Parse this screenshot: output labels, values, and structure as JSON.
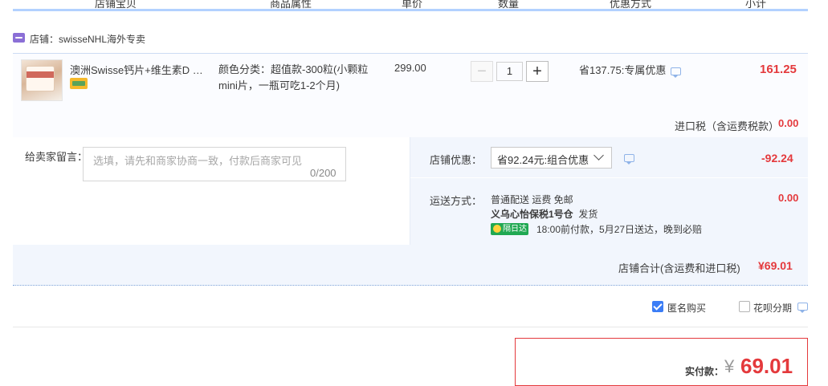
{
  "header": {
    "cols": [
      "店铺宝贝",
      "商品属性",
      "单价",
      "数量",
      "优惠方式",
      "小计"
    ]
  },
  "store": {
    "name": "店铺：swisseNHL海外专卖"
  },
  "item": {
    "title": "澳洲Swisse钙片+维生素D mini片",
    "attribute": "颜色分类：超值款-300粒(小颗粒mini片，一瓶可吃1-2个月)",
    "price": "299.00",
    "quantity": "1",
    "discount": "省137.75:专属优惠",
    "subtotal": "161.25",
    "tax_label": "进口税（含运费税款）",
    "tax_value": "0.00"
  },
  "note": {
    "label": "给卖家留言：",
    "placeholder": "选填，请先和商家协商一致，付款后商家可见",
    "count": "0/200"
  },
  "promo": {
    "label": "店铺优惠：",
    "selected": "省92.24元:组合优惠",
    "value": "-92.24"
  },
  "shipping": {
    "label": "运送方式：",
    "line1": "普通配送 运费 免邮",
    "warehouse": "义乌心怡保税1号仓",
    "ship_text": "发货",
    "badge": "隔日达",
    "delivery": "18:00前付款，5月27日送达，晚到必赔",
    "value": "0.00"
  },
  "total": {
    "label": "店铺合计(含运费和进口税)",
    "value": "¥69.01"
  },
  "options": {
    "anonymous": "匿名购买",
    "installment": "花呗分期"
  },
  "pay": {
    "label": "实付款：",
    "currency": "¥",
    "value": "69.01"
  },
  "colors": {
    "accent_red": "#e4393c",
    "header_line": "#b2d1ff",
    "checkbox_blue": "#3b7df6"
  }
}
